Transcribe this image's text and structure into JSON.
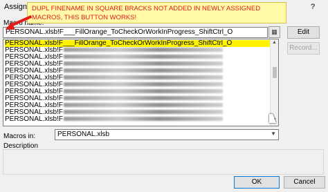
{
  "window": {
    "title": "Assign Macro",
    "help": "?"
  },
  "callout": {
    "text": "DUPL FINENAME IN SQUARE BRACKS NOT ADDED IN NEWLY ASSIGNED MACROS, THIS BUTTON WORKS!"
  },
  "macro_name": {
    "label": "Macro name:",
    "value": "PERSONAL.xlsb!F___FillOrange_ToCheckOrWorkInProgress_ShiftCtrl_O"
  },
  "macro_list": {
    "selected": "PERSONAL.xlsb!F___FillOrange_ToCheckOrWorkInProgress_ShiftCtrl_O",
    "row_prefix": "PERSONAL.xlsb!F"
  },
  "buttons": {
    "edit": "Edit",
    "record": "Record...",
    "ok": "OK",
    "cancel": "Cancel"
  },
  "macros_in": {
    "label": "Macros in:",
    "value": "PERSONAL.xlsb"
  },
  "description": {
    "label": "Description"
  },
  "colors": {
    "selection": "#fff200",
    "callout_bg": "#fff9a8",
    "callout_text": "#e21b1b"
  }
}
